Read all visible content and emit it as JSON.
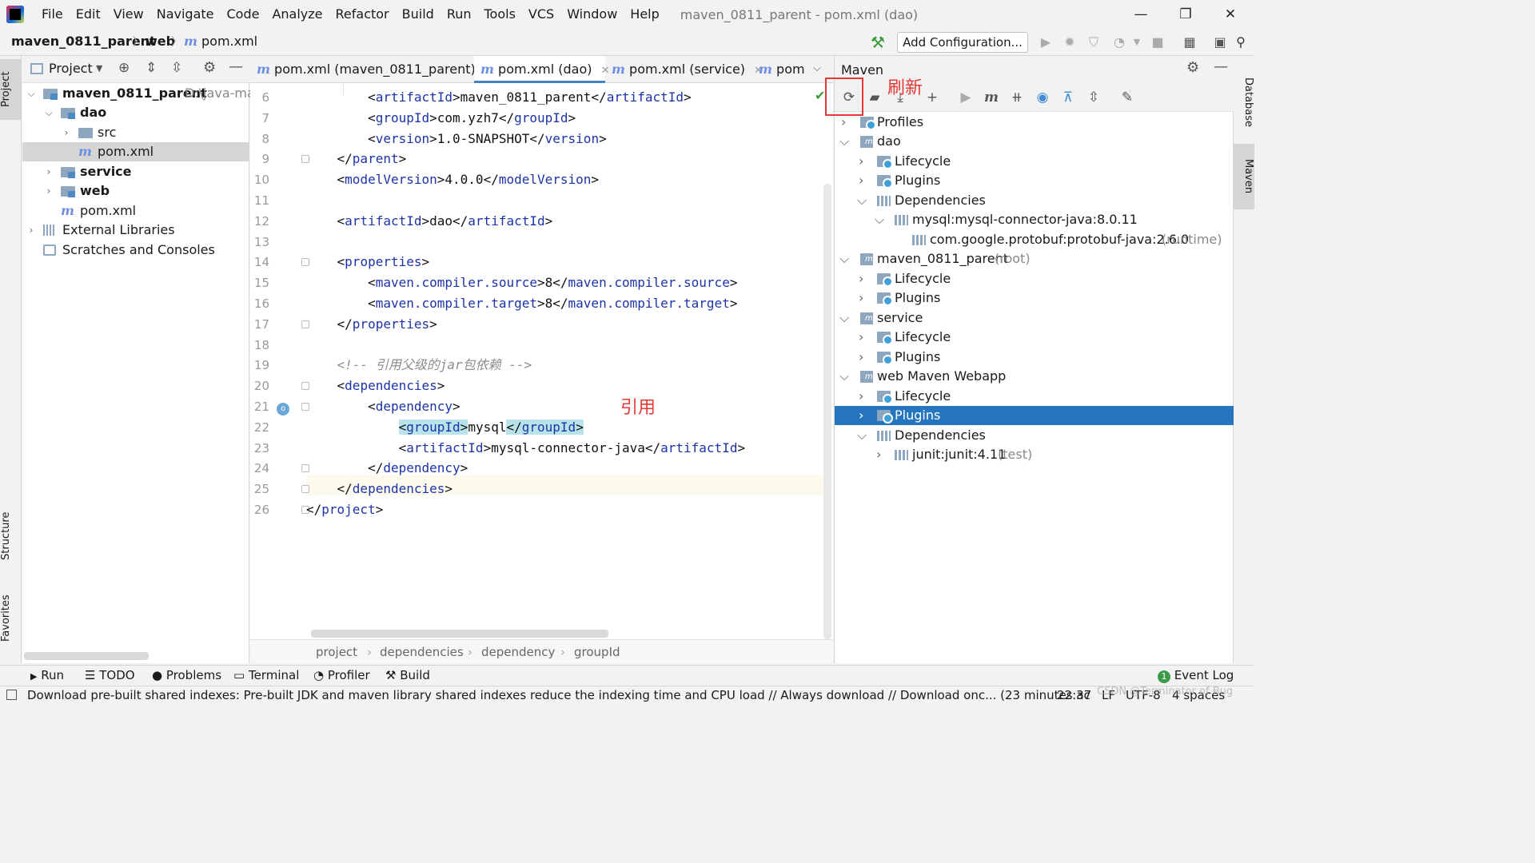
{
  "menubar": {
    "items": [
      "File",
      "Edit",
      "View",
      "Navigate",
      "Code",
      "Analyze",
      "Refactor",
      "Build",
      "Run",
      "Tools",
      "VCS",
      "Window",
      "Help"
    ],
    "window_title": "maven_0811_parent - pom.xml (dao)",
    "minimize": "—",
    "restore": "❐",
    "close": "✕"
  },
  "navbar": {
    "crumbs": [
      "maven_0811_parent",
      "web",
      "pom.xml"
    ],
    "add_configuration": "Add Configuration..."
  },
  "left_stripe": {
    "project": "Project",
    "structure": "Structure",
    "favorites": "Favorites"
  },
  "right_stripe": {
    "database": "Database",
    "maven": "Maven"
  },
  "project": {
    "title": "Project",
    "tree": [
      {
        "label": "maven_0811_parent",
        "suffix": "D:\\java-ma"
      },
      {
        "label": "dao"
      },
      {
        "label": "src"
      },
      {
        "label": "pom.xml"
      },
      {
        "label": "service"
      },
      {
        "label": "web"
      },
      {
        "label": "pom.xml"
      },
      {
        "label": "External Libraries"
      },
      {
        "label": "Scratches and Consoles"
      }
    ]
  },
  "editor": {
    "tabs": [
      {
        "label": "pom.xml (maven_0811_parent)"
      },
      {
        "label": "pom.xml (dao)"
      },
      {
        "label": "pom.xml (service)"
      },
      {
        "label": "pom"
      }
    ],
    "line_numbers": [
      "6",
      "7",
      "8",
      "9",
      "10",
      "11",
      "12",
      "13",
      "14",
      "15",
      "16",
      "17",
      "18",
      "19",
      "20",
      "21",
      "22",
      "23",
      "24",
      "25",
      "26"
    ],
    "lines": [
      {
        "pre": "        <",
        "tag": "artifactId",
        "mid": ">maven_0811_parent</",
        "tag2": "artifactId",
        "post": ">"
      },
      {
        "pre": "        <",
        "tag": "groupId",
        "mid": ">com.yzh7</",
        "tag2": "groupId",
        "post": ">"
      },
      {
        "pre": "        <",
        "tag": "version",
        "mid": ">1.0-SNAPSHOT</",
        "tag2": "version",
        "post": ">"
      },
      {
        "pre": "    </",
        "tag": "parent",
        "mid": ">",
        "tag2": "",
        "post": ""
      },
      {
        "pre": "    <",
        "tag": "modelVersion",
        "mid": ">4.0.0</",
        "tag2": "modelVersion",
        "post": ">"
      },
      {
        "pre": "",
        "tag": "",
        "mid": "",
        "tag2": "",
        "post": ""
      },
      {
        "pre": "    <",
        "tag": "artifactId",
        "mid": ">dao</",
        "tag2": "artifactId",
        "post": ">"
      },
      {
        "pre": "",
        "tag": "",
        "mid": "",
        "tag2": "",
        "post": ""
      },
      {
        "pre": "    <",
        "tag": "properties",
        "mid": ">",
        "tag2": "",
        "post": ""
      },
      {
        "pre": "        <",
        "tag": "maven.compiler.source",
        "mid": ">8</",
        "tag2": "maven.compiler.source",
        "post": ">"
      },
      {
        "pre": "        <",
        "tag": "maven.compiler.target",
        "mid": ">8</",
        "tag2": "maven.compiler.target",
        "post": ">"
      },
      {
        "pre": "    </",
        "tag": "properties",
        "mid": ">",
        "tag2": "",
        "post": ""
      },
      {
        "pre": "",
        "tag": "",
        "mid": "",
        "tag2": "",
        "post": ""
      },
      {
        "comment": "    <!-- 引用父级的jar包依赖 -->"
      },
      {
        "pre": "    <",
        "tag": "dependencies",
        "mid": ">",
        "tag2": "",
        "post": ""
      },
      {
        "pre": "        <",
        "tag": "dependency",
        "mid": ">",
        "tag2": "",
        "post": ""
      },
      {
        "pre": "            <",
        "tag": "groupId",
        "mid": ">mysql</",
        "tag2": "groupId",
        "post": ">"
      },
      {
        "pre": "            <",
        "tag": "artifactId",
        "mid": ">mysql-connector-java</",
        "tag2": "artifactId",
        "post": ">"
      },
      {
        "pre": "        </",
        "tag": "dependency",
        "mid": ">",
        "tag2": "",
        "post": ""
      },
      {
        "pre": "    </",
        "tag": "dependencies",
        "mid": ">",
        "tag2": "",
        "post": ""
      },
      {
        "pre": "</",
        "tag": "project",
        "mid": ">",
        "tag2": "",
        "post": ""
      }
    ],
    "breadcrumb": [
      "project",
      "dependencies",
      "dependency",
      "groupId"
    ]
  },
  "maven": {
    "title": "Maven",
    "tree": [
      {
        "label": "Profiles",
        "gray": ""
      },
      {
        "label": "dao",
        "gray": ""
      },
      {
        "label": "Lifecycle",
        "gray": ""
      },
      {
        "label": "Plugins",
        "gray": ""
      },
      {
        "label": "Dependencies",
        "gray": ""
      },
      {
        "label": "mysql:mysql-connector-java:8.0.11",
        "gray": ""
      },
      {
        "label": "com.google.protobuf:protobuf-java:2.6.0",
        "gray": "(runtime)"
      },
      {
        "label": "maven_0811_parent",
        "gray": "(root)"
      },
      {
        "label": "Lifecycle",
        "gray": ""
      },
      {
        "label": "Plugins",
        "gray": ""
      },
      {
        "label": "service",
        "gray": ""
      },
      {
        "label": "Lifecycle",
        "gray": ""
      },
      {
        "label": "Plugins",
        "gray": ""
      },
      {
        "label": "web Maven Webapp",
        "gray": ""
      },
      {
        "label": "Lifecycle",
        "gray": ""
      },
      {
        "label": "Plugins",
        "gray": ""
      },
      {
        "label": "Dependencies",
        "gray": ""
      },
      {
        "label": "junit:junit:4.11",
        "gray": "(test)"
      }
    ]
  },
  "annotations": {
    "refresh": "刷新",
    "reference": "引用"
  },
  "bottom_tabs": [
    "Run",
    "TODO",
    "Problems",
    "Terminal",
    "Profiler",
    "Build"
  ],
  "event_log": "Event Log",
  "event_log_badge": "1",
  "status": {
    "message": "Download pre-built shared indexes: Pre-built JDK and maven library shared indexes reduce the indexing time and CPU load // Always download // Download onc... (23 minutes ac",
    "time": "22:37",
    "line_sep": "LF",
    "encoding": "UTF-8",
    "indent": "4 spaces",
    "watermark": "CSDN @Terminator of Bug"
  }
}
